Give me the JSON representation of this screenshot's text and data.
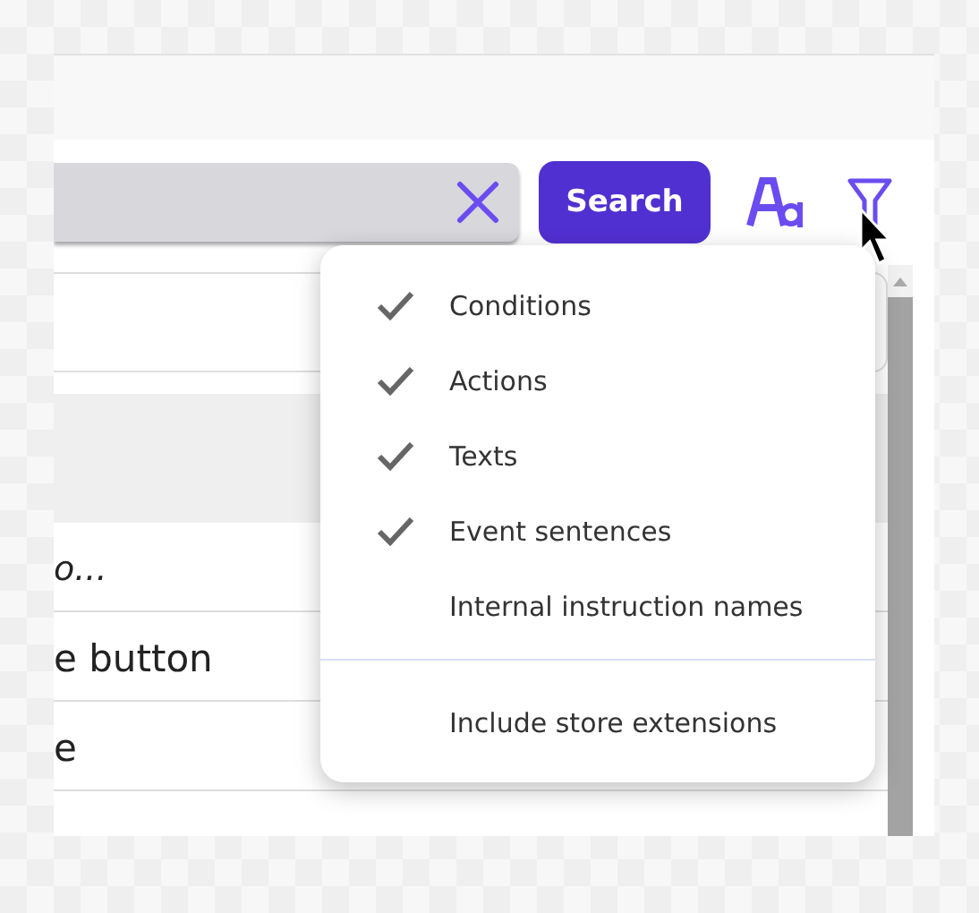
{
  "search": {
    "button": "Search"
  },
  "rows": [
    {
      "text": "o...",
      "kind": "italic"
    },
    {
      "text": "e button",
      "kind": "plain"
    },
    {
      "text": "e",
      "kind": "plain"
    }
  ],
  "filter_menu": {
    "items": [
      {
        "label": "Conditions",
        "checked": true
      },
      {
        "label": "Actions",
        "checked": true
      },
      {
        "label": "Texts",
        "checked": true
      },
      {
        "label": "Event sentences",
        "checked": true
      },
      {
        "label": "Internal instruction names",
        "checked": false
      }
    ],
    "extra_items": [
      {
        "label": "Include store extensions",
        "checked": false
      }
    ]
  }
}
